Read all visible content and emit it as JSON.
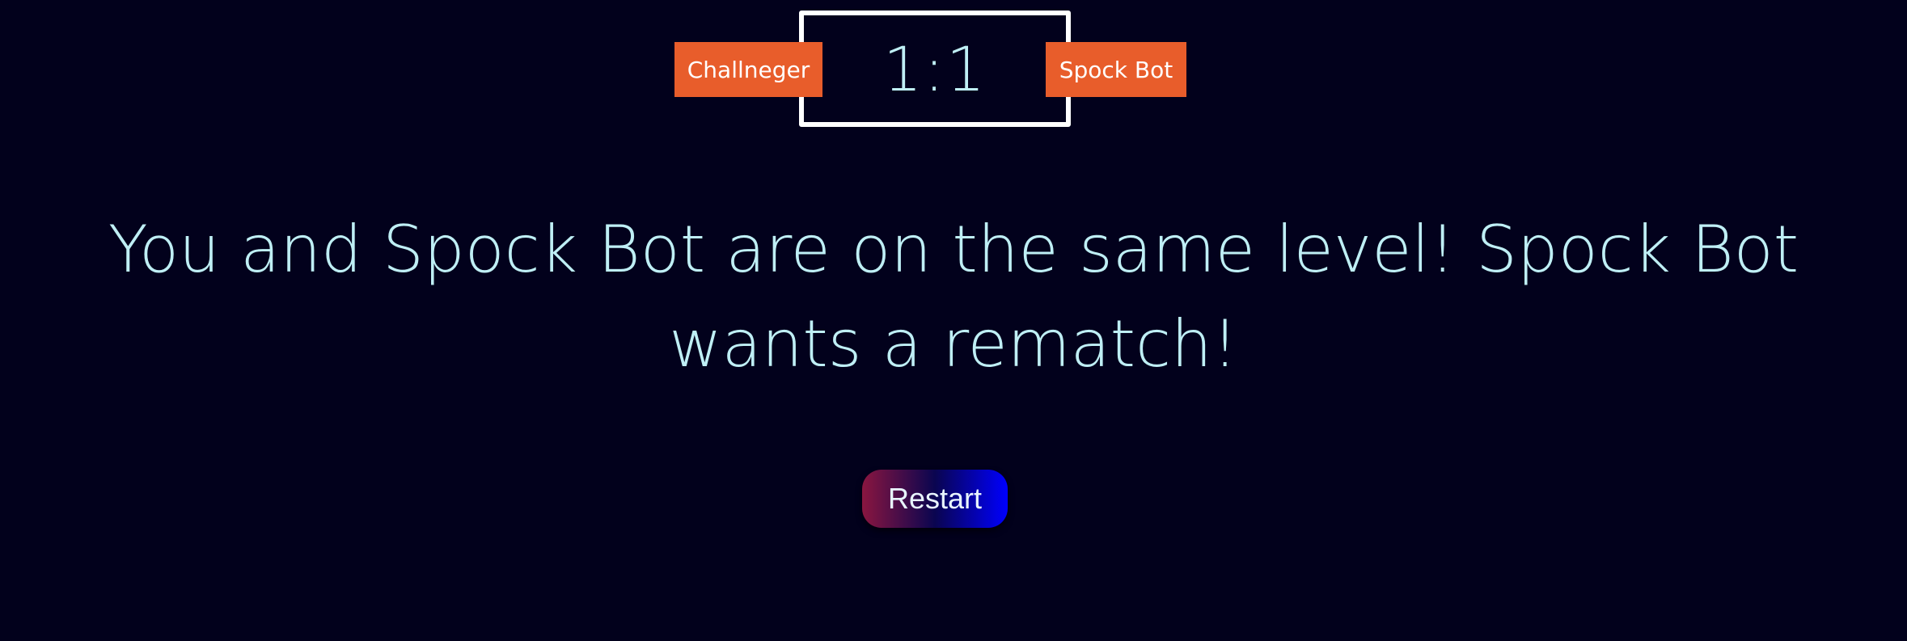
{
  "scoreboard": {
    "score": "1:1",
    "player_label": "Challneger",
    "opponent_label": "Spock Bot"
  },
  "result": {
    "message": "You and Spock Bot are on the same level! Spock Bot wants a rematch!"
  },
  "actions": {
    "restart_label": "Restart"
  },
  "colors": {
    "background": "#02011c",
    "text": "#bfeff5",
    "badge": "#e85d2b",
    "border": "#ffffff"
  }
}
